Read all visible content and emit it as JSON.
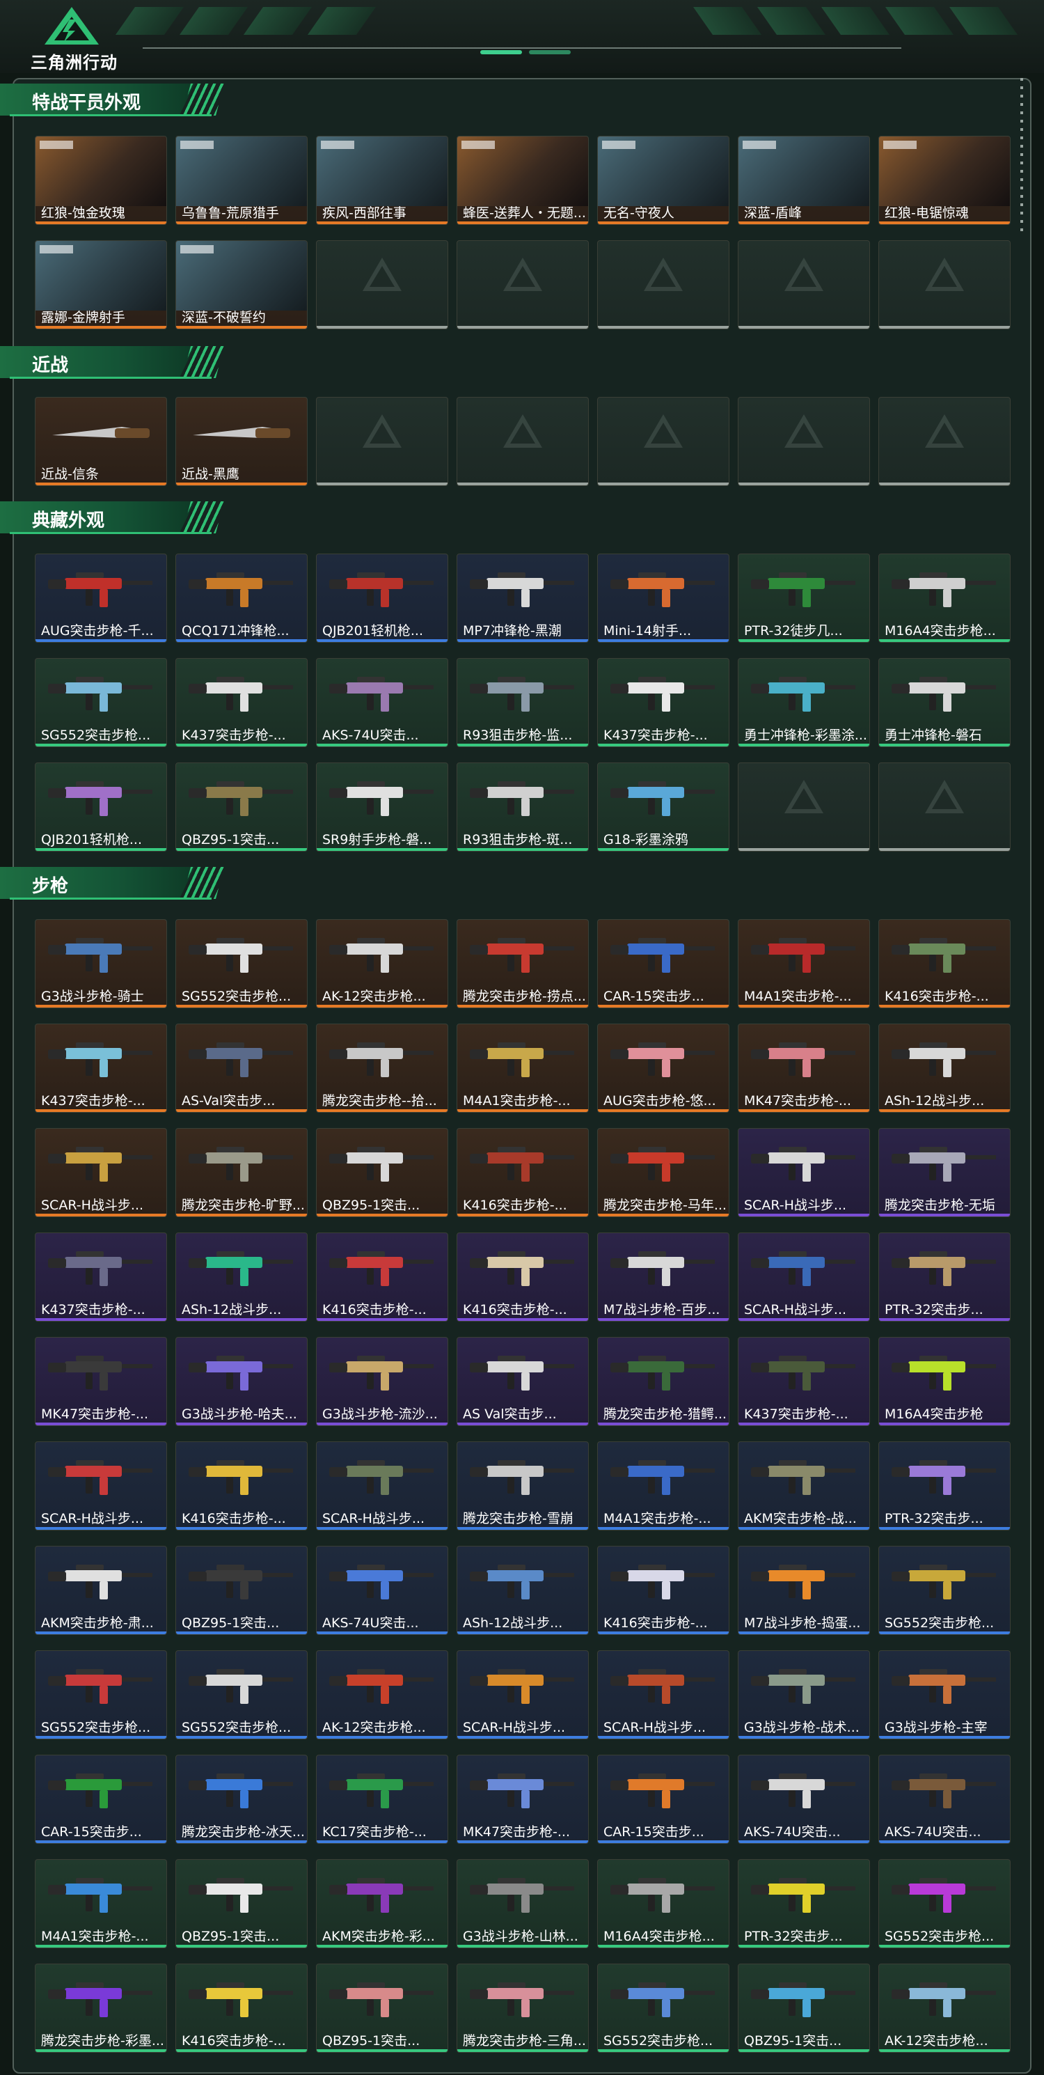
{
  "app": {
    "title": "三角洲行动"
  },
  "colors": {
    "orange": "#e67a26",
    "blue": "#3d7de0",
    "purple": "#7a4ed6",
    "green": "#37c97f",
    "gray": "#9aa39e"
  },
  "sections": [
    {
      "title": "特战干员外观",
      "items": [
        {
          "label": "红狼-蚀金玫瑰",
          "rarity": "orange",
          "kind": "operator"
        },
        {
          "label": "乌鲁鲁-荒原猎手",
          "rarity": "orange",
          "kind": "operator"
        },
        {
          "label": "疾风-西部往事",
          "rarity": "orange",
          "kind": "operator"
        },
        {
          "label": "蜂医-送葬人・无题...",
          "rarity": "orange",
          "kind": "operator"
        },
        {
          "label": "无名-守夜人",
          "rarity": "orange",
          "kind": "operator"
        },
        {
          "label": "深蓝-盾峰",
          "rarity": "orange",
          "kind": "operator"
        },
        {
          "label": "红狼-电锯惊魂",
          "rarity": "orange",
          "kind": "operator"
        },
        {
          "label": "露娜-金牌射手",
          "rarity": "orange",
          "kind": "operator"
        },
        {
          "label": "深蓝-不破誓约",
          "rarity": "orange",
          "kind": "operator"
        },
        {
          "label": "",
          "rarity": "gray",
          "kind": "empty"
        },
        {
          "label": "",
          "rarity": "gray",
          "kind": "empty"
        },
        {
          "label": "",
          "rarity": "gray",
          "kind": "empty"
        },
        {
          "label": "",
          "rarity": "gray",
          "kind": "empty"
        },
        {
          "label": "",
          "rarity": "gray",
          "kind": "empty"
        }
      ]
    },
    {
      "title": "近战",
      "items": [
        {
          "label": "近战-信条",
          "rarity": "orange",
          "kind": "knife"
        },
        {
          "label": "近战-黑鹰",
          "rarity": "orange",
          "kind": "knife"
        },
        {
          "label": "",
          "rarity": "gray",
          "kind": "empty"
        },
        {
          "label": "",
          "rarity": "gray",
          "kind": "empty"
        },
        {
          "label": "",
          "rarity": "gray",
          "kind": "empty"
        },
        {
          "label": "",
          "rarity": "gray",
          "kind": "empty"
        },
        {
          "label": "",
          "rarity": "gray",
          "kind": "empty"
        }
      ]
    },
    {
      "title": "典藏外观",
      "items": [
        {
          "label": "AUG突击步枪-千...",
          "rarity": "blue",
          "kind": "gun",
          "tint": "#c0302a"
        },
        {
          "label": "QCQ171冲锋枪...",
          "rarity": "blue",
          "kind": "gun",
          "tint": "#c87a28"
        },
        {
          "label": "QJB201轻机枪...",
          "rarity": "blue",
          "kind": "gun",
          "tint": "#b8322a"
        },
        {
          "label": "MP7冲锋枪-黑潮",
          "rarity": "blue",
          "kind": "gun",
          "tint": "#d8d8d8"
        },
        {
          "label": "Mini-14射手...",
          "rarity": "blue",
          "kind": "gun",
          "tint": "#d86a30"
        },
        {
          "label": "PTR-32徒步几...",
          "rarity": "green",
          "kind": "gun",
          "tint": "#2e8a3a"
        },
        {
          "label": "M16A4突击步枪...",
          "rarity": "green",
          "kind": "gun",
          "tint": "#cfcfcf"
        },
        {
          "label": "SG552突击步枪...",
          "rarity": "green",
          "kind": "gun",
          "tint": "#7ab8d8"
        },
        {
          "label": "K437突击步枪-...",
          "rarity": "green",
          "kind": "gun",
          "tint": "#e0e0e0"
        },
        {
          "label": "AKS-74U突击...",
          "rarity": "green",
          "kind": "gun",
          "tint": "#9a7ab0"
        },
        {
          "label": "R93狙击步枪-监...",
          "rarity": "green",
          "kind": "gun",
          "tint": "#8a9aa8"
        },
        {
          "label": "K437突击步枪-...",
          "rarity": "green",
          "kind": "gun",
          "tint": "#e8e8e8"
        },
        {
          "label": "勇士冲锋枪-彩墨涂...",
          "rarity": "green",
          "kind": "gun",
          "tint": "#4ab0c8"
        },
        {
          "label": "勇士冲锋枪-磐石",
          "rarity": "green",
          "kind": "gun",
          "tint": "#d8d8d8"
        },
        {
          "label": "QJB201轻机枪...",
          "rarity": "green",
          "kind": "gun",
          "tint": "#a070c8"
        },
        {
          "label": "QBZ95-1突击...",
          "rarity": "green",
          "kind": "gun",
          "tint": "#8a7a4a"
        },
        {
          "label": "SR9射手步枪-磐...",
          "rarity": "green",
          "kind": "gun",
          "tint": "#e0e0e0"
        },
        {
          "label": "R93狙击步枪-斑...",
          "rarity": "green",
          "kind": "gun",
          "tint": "#d0d0d0"
        },
        {
          "label": "G18-彩墨涂鸦",
          "rarity": "green",
          "kind": "gun",
          "tint": "#5aa8d8"
        },
        {
          "label": "",
          "rarity": "gray",
          "kind": "empty"
        },
        {
          "label": "",
          "rarity": "gray",
          "kind": "empty"
        }
      ]
    },
    {
      "title": "步枪",
      "items": [
        {
          "label": "G3战斗步枪-骑士",
          "rarity": "orange",
          "kind": "gun",
          "tint": "#4a7ab8"
        },
        {
          "label": "SG552突击步枪...",
          "rarity": "orange",
          "kind": "gun",
          "tint": "#e0e0e0"
        },
        {
          "label": "AK-12突击步枪...",
          "rarity": "orange",
          "kind": "gun",
          "tint": "#d8d8d8"
        },
        {
          "label": "腾龙突击步枪-捞点...",
          "rarity": "orange",
          "kind": "gun",
          "tint": "#c83a30"
        },
        {
          "label": "CAR-15突击步...",
          "rarity": "orange",
          "kind": "gun",
          "tint": "#3a6ac8"
        },
        {
          "label": "M4A1突击步枪-...",
          "rarity": "orange",
          "kind": "gun",
          "tint": "#b82a2a"
        },
        {
          "label": "K416突击步枪-...",
          "rarity": "orange",
          "kind": "gun",
          "tint": "#6a8a5a"
        },
        {
          "label": "K437突击步枪-...",
          "rarity": "orange",
          "kind": "gun",
          "tint": "#7ac0d8"
        },
        {
          "label": "AS-Val突击步...",
          "rarity": "orange",
          "kind": "gun",
          "tint": "#5a6a8a"
        },
        {
          "label": "腾龙突击步枪--拾...",
          "rarity": "orange",
          "kind": "gun",
          "tint": "#c8c8c8"
        },
        {
          "label": "M4A1突击步枪-...",
          "rarity": "orange",
          "kind": "gun",
          "tint": "#c8a84a"
        },
        {
          "label": "AUG突击步枪-悠...",
          "rarity": "orange",
          "kind": "gun",
          "tint": "#e0909a"
        },
        {
          "label": "MK47突击步枪-...",
          "rarity": "orange",
          "kind": "gun",
          "tint": "#d8808a"
        },
        {
          "label": "ASh-12战斗步...",
          "rarity": "orange",
          "kind": "gun",
          "tint": "#d8d8d8"
        },
        {
          "label": "SCAR-H战斗步...",
          "rarity": "orange",
          "kind": "gun",
          "tint": "#c8a040"
        },
        {
          "label": "腾龙突击步枪-旷野...",
          "rarity": "orange",
          "kind": "gun",
          "tint": "#9a9a8a"
        },
        {
          "label": "QBZ95-1突击...",
          "rarity": "orange",
          "kind": "gun",
          "tint": "#d8d8d8"
        },
        {
          "label": "K416突击步枪-...",
          "rarity": "orange",
          "kind": "gun",
          "tint": "#a83a2a"
        },
        {
          "label": "腾龙突击步枪-马年...",
          "rarity": "orange",
          "kind": "gun",
          "tint": "#c83a2a"
        },
        {
          "label": "SCAR-H战斗步...",
          "rarity": "purple",
          "kind": "gun",
          "tint": "#d8d8d8"
        },
        {
          "label": "腾龙突击步枪-无垢",
          "rarity": "purple",
          "kind": "gun",
          "tint": "#a8a8b8"
        },
        {
          "label": "K437突击步枪-...",
          "rarity": "purple",
          "kind": "gun",
          "tint": "#6a6a8a"
        },
        {
          "label": "ASh-12战斗步...",
          "rarity": "purple",
          "kind": "gun",
          "tint": "#2ab88a"
        },
        {
          "label": "K416突击步枪-...",
          "rarity": "purple",
          "kind": "gun",
          "tint": "#c83a3a"
        },
        {
          "label": "K416突击步枪-...",
          "rarity": "purple",
          "kind": "gun",
          "tint": "#d8c8a8"
        },
        {
          "label": "M7战斗步枪-百步...",
          "rarity": "purple",
          "kind": "gun",
          "tint": "#d8d8d8"
        },
        {
          "label": "SCAR-H战斗步...",
          "rarity": "purple",
          "kind": "gun",
          "tint": "#3a6ab8"
        },
        {
          "label": "PTR-32突击步...",
          "rarity": "purple",
          "kind": "gun",
          "tint": "#b89a6a"
        },
        {
          "label": "MK47突击步枪-...",
          "rarity": "purple",
          "kind": "gun",
          "tint": "#3a3a3a"
        },
        {
          "label": "G3战斗步枪-哈夫...",
          "rarity": "purple",
          "kind": "gun",
          "tint": "#7a6ad8"
        },
        {
          "label": "G3战斗步枪-流沙...",
          "rarity": "purple",
          "kind": "gun",
          "tint": "#c8a86a"
        },
        {
          "label": "AS Val突击步...",
          "rarity": "purple",
          "kind": "gun",
          "tint": "#d8d8d8"
        },
        {
          "label": "腾龙突击步枪-猎鳄...",
          "rarity": "purple",
          "kind": "gun",
          "tint": "#3a6a3a"
        },
        {
          "label": "K437突击步枪-...",
          "rarity": "purple",
          "kind": "gun",
          "tint": "#4a5a3a"
        },
        {
          "label": "M16A4突击步枪",
          "rarity": "purple",
          "kind": "gun",
          "tint": "#b8e02a"
        },
        {
          "label": "SCAR-H战斗步...",
          "rarity": "blue",
          "kind": "gun",
          "tint": "#c83a3a"
        },
        {
          "label": "K416突击步枪-...",
          "rarity": "blue",
          "kind": "gun",
          "tint": "#e0b83a"
        },
        {
          "label": "SCAR-H战斗步...",
          "rarity": "blue",
          "kind": "gun",
          "tint": "#6a7a5a"
        },
        {
          "label": "腾龙突击步枪-雪崩",
          "rarity": "blue",
          "kind": "gun",
          "tint": "#c8c8c8"
        },
        {
          "label": "M4A1突击步枪-...",
          "rarity": "blue",
          "kind": "gun",
          "tint": "#3a6ac8"
        },
        {
          "label": "AKM突击步枪-战...",
          "rarity": "blue",
          "kind": "gun",
          "tint": "#8a8a6a"
        },
        {
          "label": "PTR-32突击步...",
          "rarity": "blue",
          "kind": "gun",
          "tint": "#9a7ad8"
        },
        {
          "label": "AKM突击步枪-肃...",
          "rarity": "blue",
          "kind": "gun",
          "tint": "#e0e0e0"
        },
        {
          "label": "QBZ95-1突击...",
          "rarity": "blue",
          "kind": "gun",
          "tint": "#3a3a3a"
        },
        {
          "label": "AKS-74U突击...",
          "rarity": "blue",
          "kind": "gun",
          "tint": "#4a7ad8"
        },
        {
          "label": "ASh-12战斗步...",
          "rarity": "blue",
          "kind": "gun",
          "tint": "#5a8ac8"
        },
        {
          "label": "K416突击步枪-...",
          "rarity": "blue",
          "kind": "gun",
          "tint": "#d8d8e8"
        },
        {
          "label": "M7战斗步枪-捣蛋...",
          "rarity": "blue",
          "kind": "gun",
          "tint": "#e88a2a"
        },
        {
          "label": "SG552突击步枪...",
          "rarity": "blue",
          "kind": "gun",
          "tint": "#c8a83a"
        },
        {
          "label": "SG552突击步枪...",
          "rarity": "blue",
          "kind": "gun",
          "tint": "#c83a3a"
        },
        {
          "label": "SG552突击步枪...",
          "rarity": "blue",
          "kind": "gun",
          "tint": "#d8d8d8"
        },
        {
          "label": "AK-12突击步枪...",
          "rarity": "blue",
          "kind": "gun",
          "tint": "#c8402a"
        },
        {
          "label": "SCAR-H战斗步...",
          "rarity": "blue",
          "kind": "gun",
          "tint": "#d88a2a"
        },
        {
          "label": "SCAR-H战斗步...",
          "rarity": "blue",
          "kind": "gun",
          "tint": "#b84a2a"
        },
        {
          "label": "G3战斗步枪-战术...",
          "rarity": "blue",
          "kind": "gun",
          "tint": "#8a9a8a"
        },
        {
          "label": "G3战斗步枪-主宰",
          "rarity": "blue",
          "kind": "gun",
          "tint": "#c8703a"
        },
        {
          "label": "CAR-15突击步...",
          "rarity": "blue",
          "kind": "gun",
          "tint": "#2a9a3a"
        },
        {
          "label": "腾龙突击步枪-冰天...",
          "rarity": "blue",
          "kind": "gun",
          "tint": "#3a7ad8"
        },
        {
          "label": "KC17突击步枪-...",
          "rarity": "blue",
          "kind": "gun",
          "tint": "#2a9a4a"
        },
        {
          "label": "MK47突击步枪-...",
          "rarity": "blue",
          "kind": "gun",
          "tint": "#6a8ad8"
        },
        {
          "label": "CAR-15突击步...",
          "rarity": "blue",
          "kind": "gun",
          "tint": "#e07a2a"
        },
        {
          "label": "AKS-74U突击...",
          "rarity": "blue",
          "kind": "gun",
          "tint": "#d8d8d8"
        },
        {
          "label": "AKS-74U突击...",
          "rarity": "blue",
          "kind": "gun",
          "tint": "#7a5a3a"
        },
        {
          "label": "M4A1突击步枪-...",
          "rarity": "green",
          "kind": "gun",
          "tint": "#3a8ad8"
        },
        {
          "label": "QBZ95-1突击...",
          "rarity": "green",
          "kind": "gun",
          "tint": "#e8e8e8"
        },
        {
          "label": "AKM突击步枪-彩...",
          "rarity": "green",
          "kind": "gun",
          "tint": "#8a3ab8"
        },
        {
          "label": "G3战斗步枪-山林...",
          "rarity": "green",
          "kind": "gun",
          "tint": "#8a8a8a"
        },
        {
          "label": "M16A4突击步枪...",
          "rarity": "green",
          "kind": "gun",
          "tint": "#a8a8a8"
        },
        {
          "label": "PTR-32突击步...",
          "rarity": "green",
          "kind": "gun",
          "tint": "#e0d02a"
        },
        {
          "label": "SG552突击步枪...",
          "rarity": "green",
          "kind": "gun",
          "tint": "#b83ad8"
        },
        {
          "label": "腾龙突击步枪-彩墨...",
          "rarity": "green",
          "kind": "gun",
          "tint": "#7a3ad8"
        },
        {
          "label": "K416突击步枪-...",
          "rarity": "green",
          "kind": "gun",
          "tint": "#e8c83a"
        },
        {
          "label": "QBZ95-1突击...",
          "rarity": "green",
          "kind": "gun",
          "tint": "#d88a8a"
        },
        {
          "label": "腾龙突击步枪-三角...",
          "rarity": "green",
          "kind": "gun",
          "tint": "#d8909a"
        },
        {
          "label": "SG552突击步枪...",
          "rarity": "green",
          "kind": "gun",
          "tint": "#5a8ad8"
        },
        {
          "label": "QBZ95-1突击...",
          "rarity": "green",
          "kind": "gun",
          "tint": "#4aa8d8"
        },
        {
          "label": "AK-12突击步枪...",
          "rarity": "green",
          "kind": "gun",
          "tint": "#8ab8d8"
        }
      ]
    }
  ]
}
